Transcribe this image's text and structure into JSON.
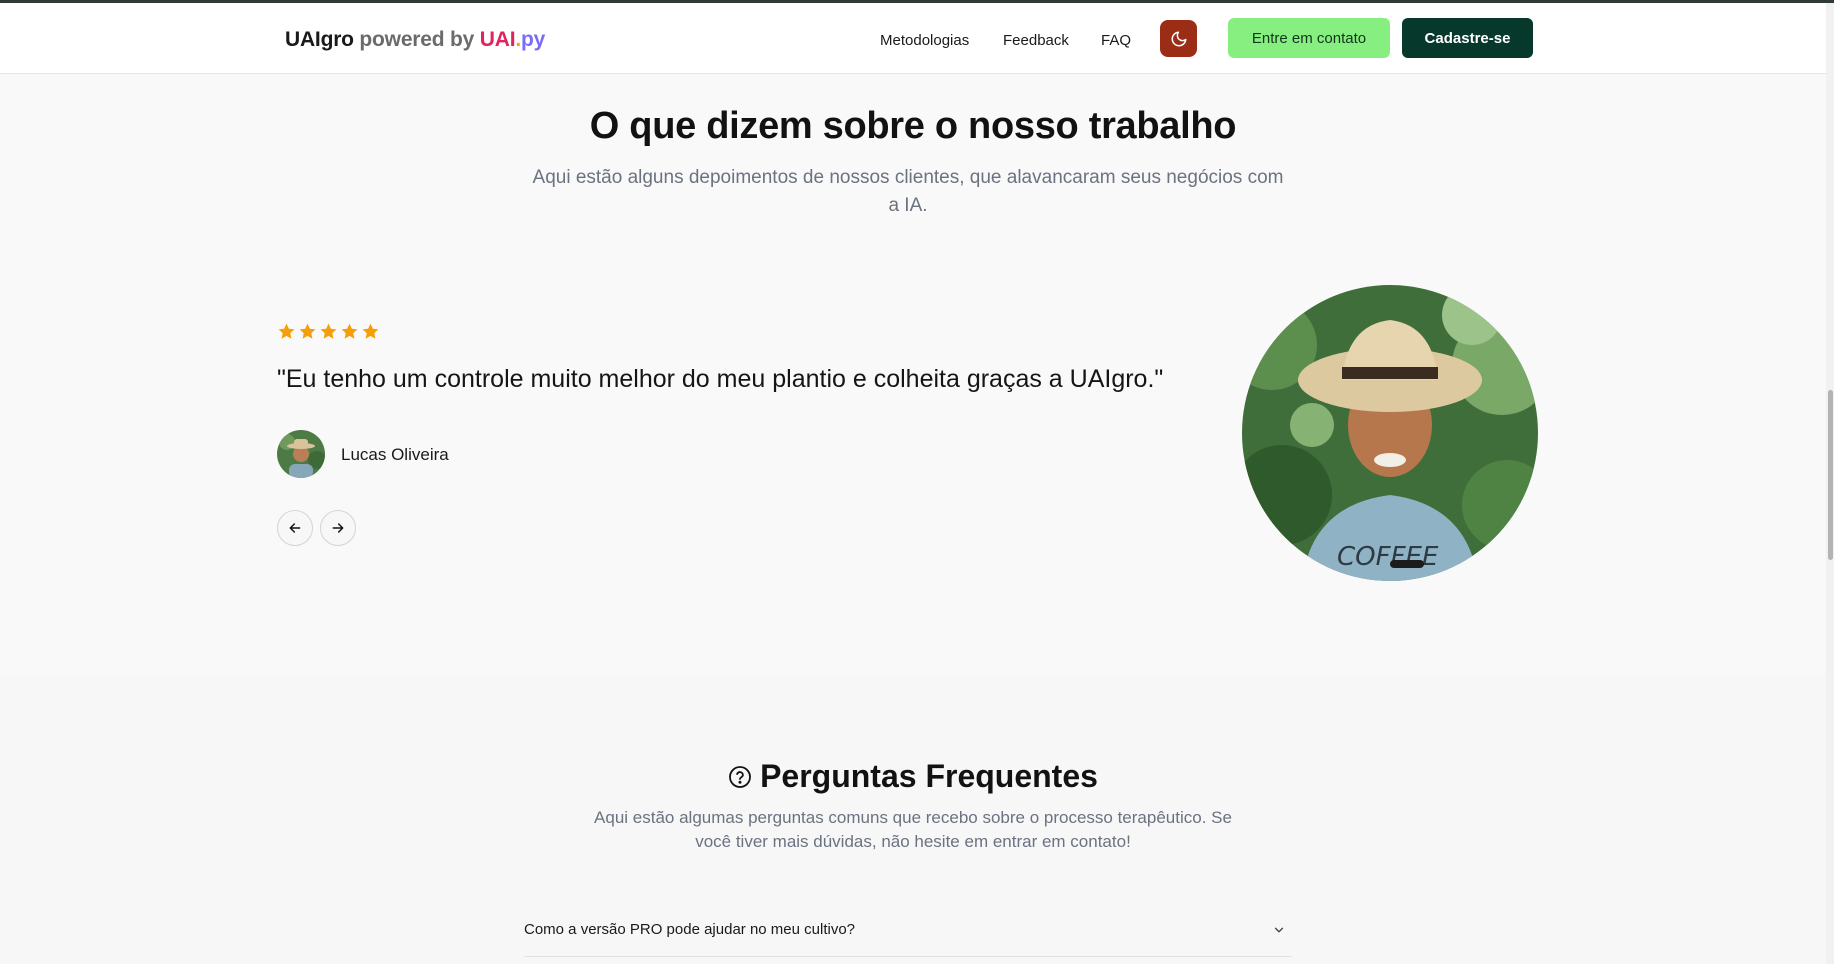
{
  "header": {
    "brand_main": "UAIgro",
    "brand_powered": " powered by ",
    "brand_uai": "UAI",
    "brand_dot": ".",
    "brand_py": "py",
    "nav": [
      "Metodologias",
      "Feedback",
      "FAQ"
    ],
    "theme_icon": "moon-icon",
    "contact_label": "Entre em contato",
    "signup_label": "Cadastre-se",
    "colors": {
      "contact_bg": "#86ef7f",
      "signup_bg": "#06382c",
      "theme_bg": "#9b2d17"
    }
  },
  "testimonials": {
    "title": "O que dizem sobre o nosso trabalho",
    "subtitle": "Aqui estão alguns depoimentos de nossos clientes, que alavancaram seus negócios com a IA.",
    "rating": 5,
    "star_color": "#f59e0b",
    "quote": "\"Eu tenho um controle muito melhor do meu plantio e colheita graças a UAIgro.\"",
    "author": "Lucas Oliveira",
    "prev_icon": "arrow-left-icon",
    "next_icon": "arrow-right-icon"
  },
  "faq": {
    "title_icon": "help-circle-icon",
    "title": "Perguntas Frequentes",
    "subtitle": "Aqui estão algumas perguntas comuns que recebo sobre o processo terapêutico. Se você tiver mais dúvidas, não hesite em entrar em contato!",
    "items": [
      {
        "question": "Como a versão PRO pode ajudar no meu cultivo?"
      }
    ]
  }
}
